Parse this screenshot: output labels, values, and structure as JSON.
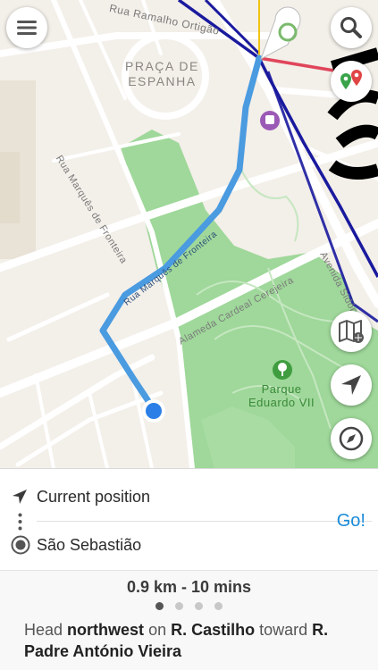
{
  "map": {
    "labels": {
      "rua_top": "Rua Ramalho Ortigão",
      "praca_line1": "PRAÇA DE",
      "praca_line2": "ESPANHA",
      "rua_marques": "Rua Marquês de Fronteira",
      "rua_marques_route": "Rua Marquês de Fronteira",
      "alameda": "Alameda Cardeal Cerejeira",
      "avenida": "Avenida Sidónio",
      "parque_line1": "Parque",
      "parque_line2": "Eduardo VII"
    },
    "colors": {
      "route": "#4a9be0",
      "park": "#9fd89a",
      "metro_blue": "#1a1a9e",
      "metro_red": "#e0455a",
      "location_dot": "#2b7fe6"
    }
  },
  "controls": {
    "menu": "menu-icon",
    "search": "search-icon",
    "pins": "route-pins-icon",
    "map_type": "map-layers-icon",
    "locate": "location-arrow-icon",
    "compass": "compass-icon"
  },
  "route": {
    "from_label": "Current position",
    "to_label": "São Sebastião",
    "go_label": "Go!"
  },
  "summary": {
    "distance_time": "0.9 km - 10 mins",
    "pages": 4,
    "active_page": 1
  },
  "instruction": {
    "part1": "Head ",
    "direction": "northwest",
    "part2": " on ",
    "street": "R. Castilho",
    "part3": " toward ",
    "target": "R. Padre António Vieira"
  }
}
